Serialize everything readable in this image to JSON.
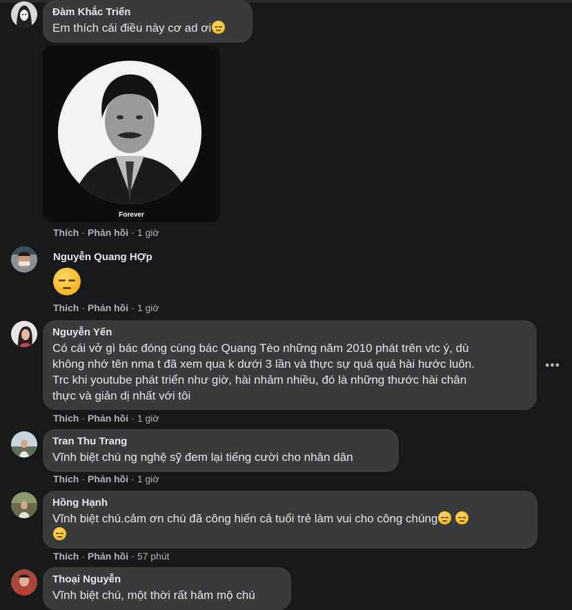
{
  "comments": [
    {
      "name": "Đàm Khắc Triển",
      "text": "Em thích cái điều này cơ ad ơi",
      "photo_caption": "Forever",
      "actions": {
        "like": "Thích",
        "reply": "Phản hồi",
        "time": "1 giờ"
      },
      "emoji": "disappointed-emoji"
    },
    {
      "name": "Nguyễn Quang HỢp",
      "actions": {
        "like": "Thích",
        "reply": "Phản hồi",
        "time": "1 giờ"
      },
      "emoji": "disappointed-emoji"
    },
    {
      "name": "Nguyễn Yến",
      "lines": [
        "Có cái vở gì bác đóng cùng bác Quang Tèo những năm 2010 phát trên vtc ý, dù",
        "không nhớ tên nma t đã xem qua k dưới 3 lần và thực sự quá quá hài hước luôn.",
        "Trc khi youtube phát triển như giờ, hài nhảm nhiều, đó là những thước hài chân",
        "thực và giản dị nhất với tôi"
      ],
      "actions": {
        "like": "Thích",
        "reply": "Phản hồi",
        "time": "1 giờ"
      },
      "more_label": "•••"
    },
    {
      "name": "Tran Thu Trang",
      "text": "Vĩnh biệt chú ng nghệ sỹ đem lại tiếng cười cho nhân dân",
      "actions": {
        "like": "Thích",
        "reply": "Phản hồi",
        "time": "1 giờ"
      }
    },
    {
      "name": "Hồng Hạnh",
      "text": "Vĩnh biệt chú.cảm ơn chú đã công hiến cả tuổi trẻ làm vui cho công chúng",
      "actions": {
        "like": "Thích",
        "reply": "Phản hồi",
        "time": "57 phút"
      },
      "emoji": "sleepy-face-emoji"
    },
    {
      "name": "Thoại Nguyễn",
      "text": "Vĩnh biệt chú, một thời rất hâm mộ chú"
    }
  ],
  "colors": {
    "background": "#18191a",
    "bubble": "#3a3b3c",
    "text": "#e4e6eb",
    "secondary": "#b0b3b8"
  }
}
